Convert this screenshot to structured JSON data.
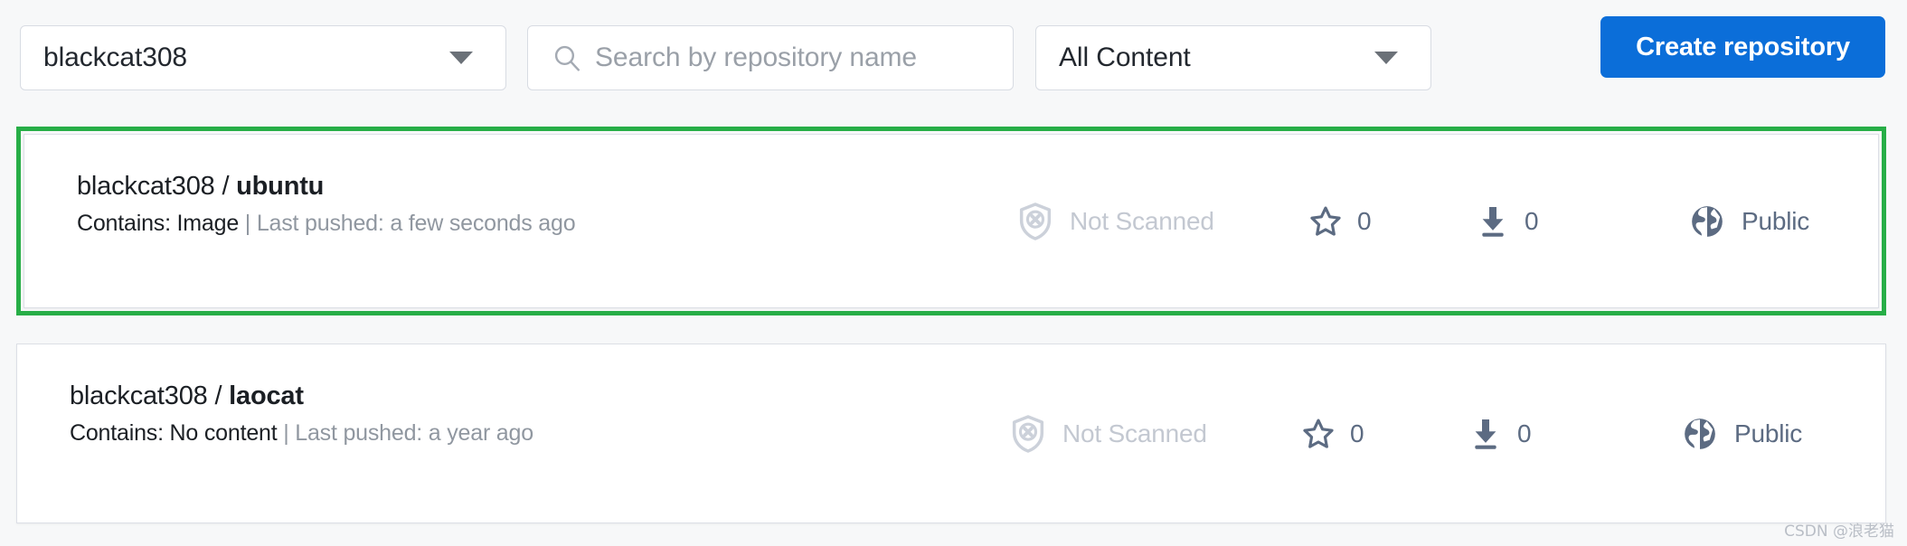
{
  "toolbar": {
    "namespace_select": {
      "value": "blackcat308",
      "icon": "chevron-down-icon"
    },
    "search": {
      "value": "",
      "placeholder": "Search by repository name",
      "icon": "search-icon"
    },
    "content_select": {
      "value": "All Content",
      "icon": "chevron-down-icon"
    },
    "create_button": {
      "label": "Create repository",
      "color": "#0b6ed9"
    }
  },
  "repositories": [
    {
      "namespace": "blackcat308",
      "separator": "/",
      "name": "ubuntu",
      "contains_label": "Contains: Image",
      "pushed_label": "| Last pushed: a few seconds ago",
      "scan_status": "Not Scanned",
      "scan_icon": "shield-x-icon",
      "stars": "0",
      "star_icon": "star-icon",
      "pulls": "0",
      "pull_icon": "download-icon",
      "visibility": "Public",
      "visibility_icon": "globe-icon",
      "highlighted": true,
      "highlight_color": "#27ae47"
    },
    {
      "namespace": "blackcat308",
      "separator": "/",
      "name": "laocat",
      "contains_label": "Contains: No content",
      "pushed_label": "| Last pushed: a year ago",
      "scan_status": "Not Scanned",
      "scan_icon": "shield-x-icon",
      "stars": "0",
      "star_icon": "star-icon",
      "pulls": "0",
      "pull_icon": "download-icon",
      "visibility": "Public",
      "visibility_icon": "globe-icon",
      "highlighted": false
    }
  ],
  "watermark": "CSDN @浪老猫"
}
